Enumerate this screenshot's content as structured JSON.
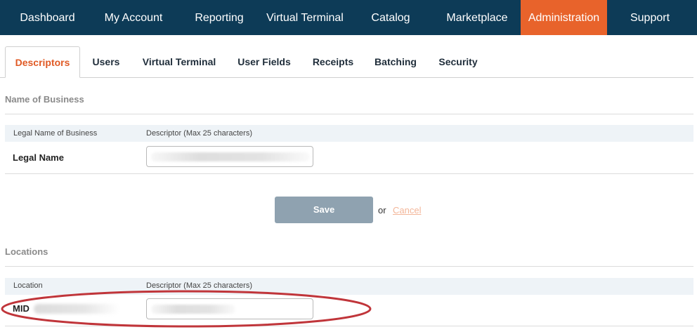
{
  "top_nav": {
    "items": [
      {
        "label": "Dashboard"
      },
      {
        "label": "My Account"
      },
      {
        "label": "Reporting"
      },
      {
        "label": "Virtual Terminal"
      },
      {
        "label": "Catalog"
      },
      {
        "label": "Marketplace"
      },
      {
        "label": "Administration",
        "active": true
      },
      {
        "label": "Support"
      }
    ],
    "bg_color": "#0d3b57",
    "active_color": "#e8632b"
  },
  "tabs": {
    "items": [
      {
        "label": "Descriptors",
        "active": true
      },
      {
        "label": "Users"
      },
      {
        "label": "Virtual Terminal"
      },
      {
        "label": "User Fields"
      },
      {
        "label": "Receipts"
      },
      {
        "label": "Batching"
      },
      {
        "label": "Security"
      }
    ],
    "active_color": "#e05a25"
  },
  "business_section": {
    "title": "Name of Business",
    "col_left_header": "Legal Name of Business",
    "col_right_header": "Descriptor (Max 25 characters)",
    "row_label": "Legal Name",
    "descriptor_value": ""
  },
  "actions": {
    "save_label": "Save",
    "or_label": "or",
    "cancel_label": "Cancel"
  },
  "locations_section": {
    "title": "Locations",
    "col_left_header": "Location",
    "col_right_header": "Descriptor (Max 25 characters)",
    "row_label": "MID",
    "descriptor_value": ""
  },
  "annotation_color": "#c0353a"
}
